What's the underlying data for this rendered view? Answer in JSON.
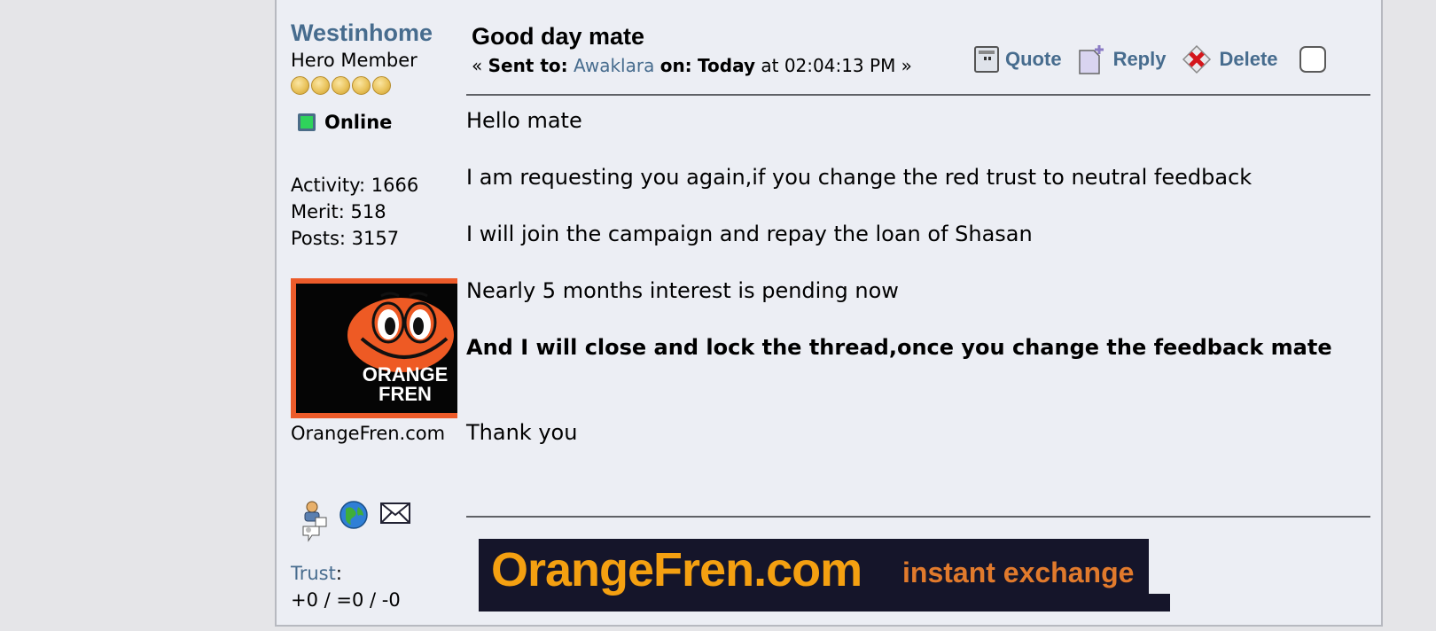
{
  "poster": {
    "name": "Westinhome",
    "rank": "Hero Member",
    "star_count": 5,
    "status": "Online",
    "activity": "Activity: 1666",
    "merit": "Merit: 518",
    "posts": "Posts: 3157",
    "avatar_text_line1": "ORANGE",
    "avatar_text_line2": "FREN",
    "avatar_caption": "OrangeFren.com",
    "contact_icons": [
      "profile-icon",
      "website-icon",
      "email-icon"
    ],
    "trust_label": "Trust",
    "trust_sep": ":",
    "trust_value": "+0 / =0 / -0"
  },
  "message": {
    "subject": "Good day mate",
    "sent_prefix": "« ",
    "sent_to_label": "Sent to:",
    "recipient": "Awaklara",
    "on_label": "on:",
    "day": "Today",
    "at_text": "at 02:04:13 PM »",
    "actions": {
      "quote": "Quote",
      "reply": "Reply",
      "delete": "Delete"
    },
    "body": {
      "p1": "Hello mate",
      "p2": "I am requesting you again,if you change the red trust to neutral feedback",
      "p3": "I will join the campaign and repay the loan of Shasan",
      "p4": "Nearly 5 months interest is pending now",
      "p5": "And I will close and lock the thread,once you change the feedback mate",
      "p6": "Thank you"
    }
  },
  "signature": {
    "brand": "OrangeFren.com",
    "tagline": "instant exchange"
  },
  "colors": {
    "link": "#476c8e",
    "online": "#2fd35b",
    "brand_orange": "#f4a011",
    "avatar_border": "#ec5b2a"
  }
}
